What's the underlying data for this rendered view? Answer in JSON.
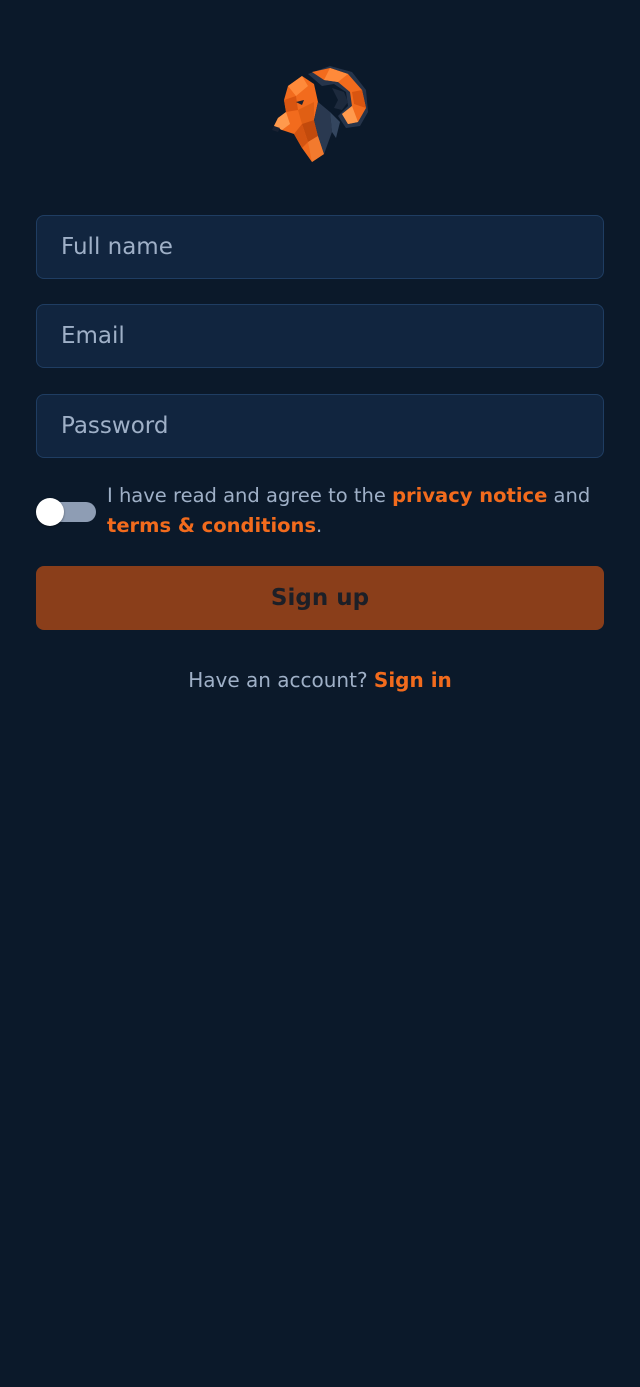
{
  "brand": {
    "logo_icon": "ram-head-icon",
    "accent_color": "#f26b1d",
    "background_color": "#0b192a"
  },
  "form": {
    "full_name_placeholder": "Full name",
    "full_name_value": "",
    "email_placeholder": "Email",
    "email_value": "",
    "password_placeholder": "Password",
    "password_value": ""
  },
  "agreement": {
    "toggle_on": false,
    "text_prefix": "I have read and agree to the ",
    "privacy_link": "privacy notice",
    "text_middle": " and ",
    "terms_link": "terms & conditions",
    "text_suffix": "."
  },
  "signup_button_label": "Sign up",
  "footer": {
    "prompt": "Have an account? ",
    "signin_link": "Sign in"
  }
}
